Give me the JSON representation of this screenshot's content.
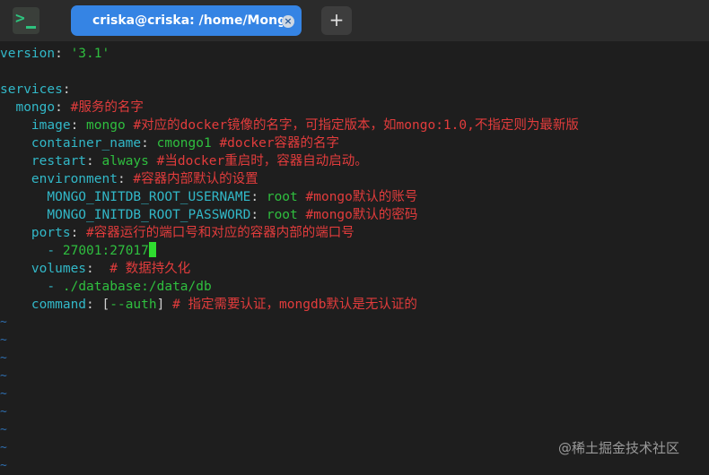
{
  "tab": {
    "title": "criska@criska: /home/MongoDB",
    "close_glyph": "×"
  },
  "new_tab_glyph": "+",
  "app_icon": {
    "glyph": ">",
    "name": "terminal-icon"
  },
  "code": {
    "l1_key": "version",
    "l1_val": "'3.1'",
    "l2_key": "services",
    "l3_key": "mongo",
    "l3_comment": "#服务的名字",
    "l4_key": "image",
    "l4_val": "mongo",
    "l4_comment": "#对应的docker镜像的名字，可指定版本，如mongo:1.0,不指定则为最新版",
    "l5_key": "container_name",
    "l5_val": "cmongo1",
    "l5_comment": "#docker容器的名字",
    "l6_key": "restart",
    "l6_val": "always",
    "l6_comment": "#当docker重启时，容器自动启动。",
    "l7_key": "environment",
    "l7_comment": "#容器内部默认的设置",
    "l8_key": "MONGO_INITDB_ROOT_USERNAME",
    "l8_val": "root",
    "l8_comment": "#mongo默认的账号",
    "l9_key": "MONGO_INITDB_ROOT_PASSWORD",
    "l9_val": "root",
    "l9_comment": "#mongo默认的密码",
    "l10_key": "ports",
    "l10_comment": "#容器运行的端口号和对应的容器内部的端口号",
    "l11_dash": "- ",
    "l11_val": "27001:27017",
    "l12_key": "volumes",
    "l12_comment": "# 数据持久化",
    "l13_dash": "- ",
    "l13_val": "./database:/data/db",
    "l14_key": "command",
    "l14_open": "[",
    "l14_val": "--auth",
    "l14_close": "]",
    "l14_comment": "# 指定需要认证，mongdb默认是无认证的"
  },
  "tilde": "~",
  "watermark": "@稀土掘金技术社区",
  "colors": {
    "key": "#32b8c8",
    "value": "#2fbf3f",
    "comment": "#e23c3c",
    "accent": "#3584e4"
  }
}
